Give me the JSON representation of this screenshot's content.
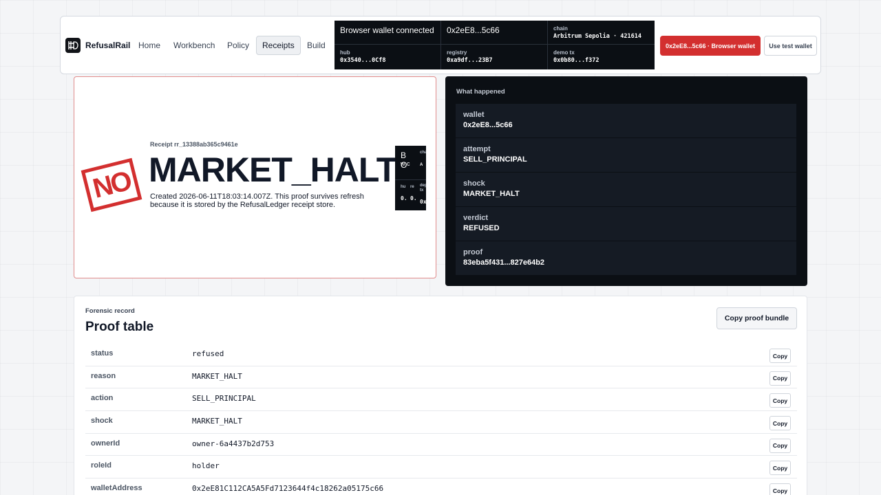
{
  "header": {
    "brand": "RefusalRail",
    "nav": [
      "Home",
      "Workbench",
      "Policy",
      "Receipts",
      "Build"
    ],
    "active_nav": "Receipts",
    "status": {
      "connection": "Browser wallet connected",
      "address": "0x2eE8...5c66",
      "chain_label": "chain",
      "chain_value": "Arbitrum Sepolia · 421614",
      "hub_label": "hub",
      "hub_value": "0x3540...0Cf8",
      "registry_label": "registry",
      "registry_value": "0xa9df...23B7",
      "demo_label": "demo tx",
      "demo_value": "0x0b80...f372"
    },
    "wallet_button": "0x2eE8...5c66 · Browser wallet",
    "test_wallet_button": "Use test wallet"
  },
  "receipt": {
    "stamp": "NO",
    "id_label": "Receipt rr_13388ab365c9461e",
    "title": "MARKET_HALT",
    "created": "Created 2026-06-11T18:03:14.007Z. This proof survives refresh because it is stored by the RefusalLedger receipt store.",
    "mini_panel": {
      "connection": "B O",
      "sub": "w c",
      "chain_label": "chain",
      "chain_value": "A",
      "hub_label": "hu",
      "registry_label": "re",
      "demo_label": "depo tx",
      "hub_value": "0.",
      "registry_value": "0.",
      "demo_value": "0x"
    }
  },
  "what_happened": {
    "title": "What happened",
    "rows": [
      {
        "label": "wallet",
        "value": "0x2eE8...5c66"
      },
      {
        "label": "attempt",
        "value": "SELL_PRINCIPAL"
      },
      {
        "label": "shock",
        "value": "MARKET_HALT"
      },
      {
        "label": "verdict",
        "value": "REFUSED"
      },
      {
        "label": "proof",
        "value": "83eba5f431...827e64b2"
      }
    ]
  },
  "forensic": {
    "eyebrow": "Forensic record",
    "title": "Proof table",
    "copy_bundle": "Copy proof bundle",
    "copy_label": "Copy",
    "rows": [
      {
        "key": "status",
        "value": "refused"
      },
      {
        "key": "reason",
        "value": "MARKET_HALT"
      },
      {
        "key": "action",
        "value": "SELL_PRINCIPAL"
      },
      {
        "key": "shock",
        "value": "MARKET_HALT"
      },
      {
        "key": "ownerId",
        "value": "owner-6a4437b2d753"
      },
      {
        "key": "roleId",
        "value": "holder"
      },
      {
        "key": "walletAddress",
        "value": "0x2eE81C112CA5A5Fd7123644f4c18262a05175c66"
      }
    ]
  },
  "colors": {
    "accent_red": "#d32f2f",
    "dark_panel": "#0b0f14"
  }
}
